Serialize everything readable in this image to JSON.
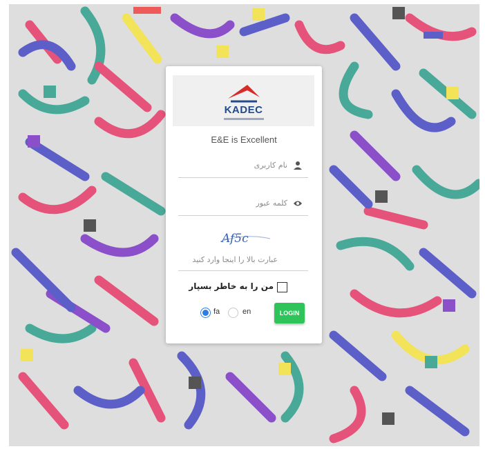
{
  "brand": {
    "logo_text": "KADEC",
    "tagline": "E&E is Excellent"
  },
  "form": {
    "username_placeholder": "نام کاربری",
    "password_placeholder": "کلمه عبور",
    "captcha_text": "Af5c",
    "captcha_placeholder": "عبارت بالا را اینجا وارد کنید",
    "remember_label": "من را به خاطر بسپار",
    "remember_checked": false,
    "languages": [
      {
        "label": "fa",
        "selected": true
      },
      {
        "label": "en",
        "selected": false
      }
    ],
    "login_label": "LOGIN"
  },
  "colors": {
    "accent_blue": "#2f7de0",
    "login_green": "#2ec45a",
    "logo_red": "#d52b2b",
    "logo_navy": "#234a8a",
    "background": "#dedede"
  },
  "icons": {
    "username": "user-icon",
    "password": "eye-icon"
  }
}
